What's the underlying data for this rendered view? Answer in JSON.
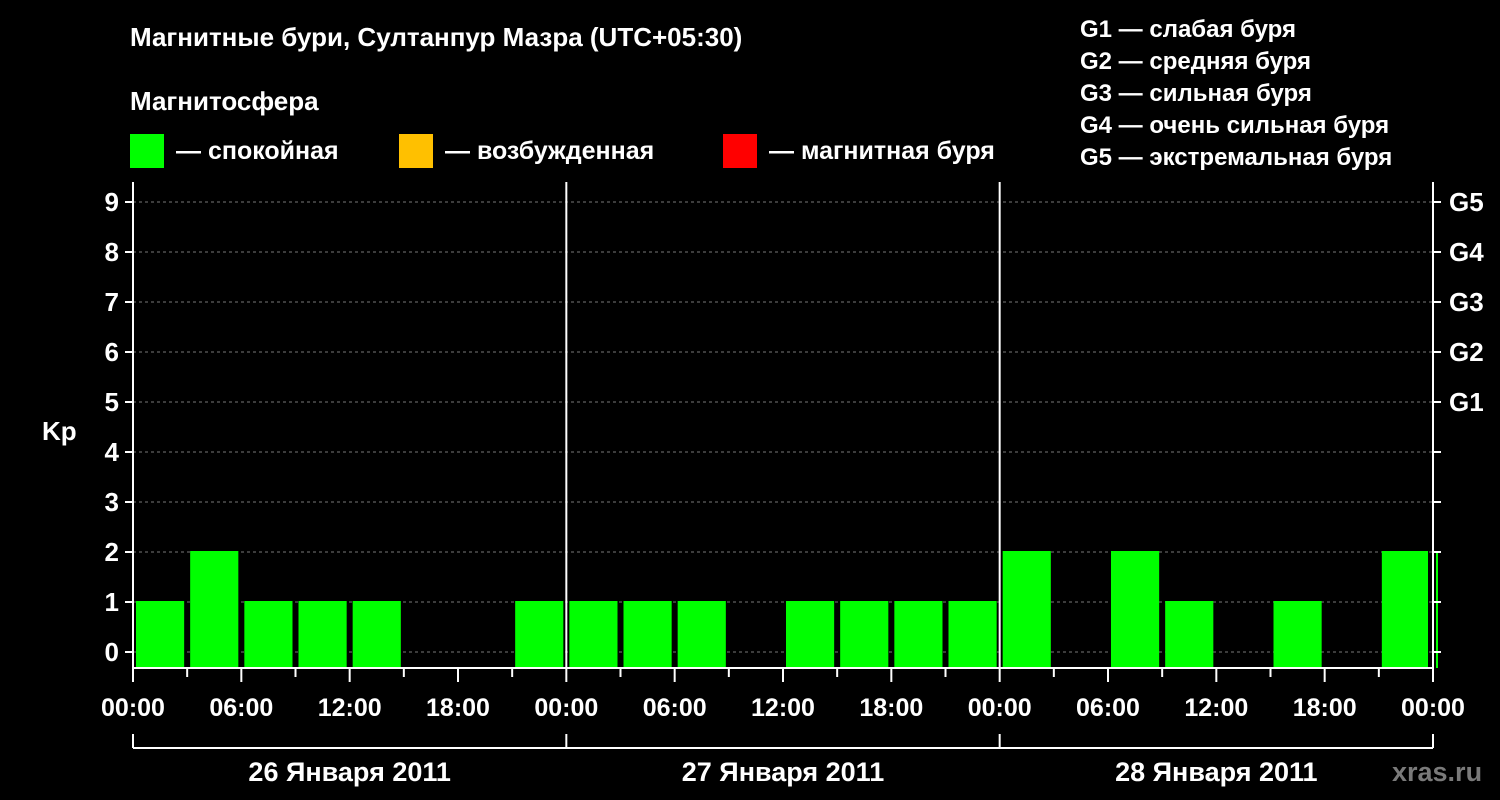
{
  "chart_data": {
    "type": "bar",
    "title": "Магнитные бури, Султанпур Мазра (UTC+05:30)",
    "subtitle": "Магнитосфера",
    "ylabel": "Kp",
    "ylim": [
      0,
      9
    ],
    "yticks": [
      "0",
      "1",
      "2",
      "3",
      "4",
      "5",
      "6",
      "7",
      "8",
      "9"
    ],
    "right_ticks": [
      {
        "value": 5,
        "label": "G1"
      },
      {
        "value": 6,
        "label": "G2"
      },
      {
        "value": 7,
        "label": "G3"
      },
      {
        "value": 8,
        "label": "G4"
      },
      {
        "value": 9,
        "label": "G5"
      }
    ],
    "legend": [
      {
        "label": "— спокойная",
        "color": "#00ff00"
      },
      {
        "label": "— возбужденная",
        "color": "#ffc000"
      },
      {
        "label": "— магнитная буря",
        "color": "#ff0000"
      }
    ],
    "g_legend": [
      "G1 — слабая буря",
      "G2 — средняя буря",
      "G3 — сильная буря",
      "G4 — очень сильная буря",
      "G5 — экстремальная буря"
    ],
    "xtick_labels": [
      "00:00",
      "06:00",
      "12:00",
      "18:00",
      "00:00",
      "06:00",
      "12:00",
      "18:00",
      "00:00",
      "06:00",
      "12:00",
      "18:00",
      "00:00"
    ],
    "days": [
      "26 Января 2011",
      "27 Января 2011",
      "28 Января 2011"
    ],
    "interval_hours": 3,
    "values": [
      1,
      2,
      1,
      1,
      1,
      0,
      0,
      1,
      1,
      1,
      1,
      0,
      1,
      1,
      1,
      1,
      2,
      0,
      2,
      1,
      0,
      1,
      0,
      2,
      2
    ],
    "grid": true
  },
  "watermark": "xras.ru"
}
